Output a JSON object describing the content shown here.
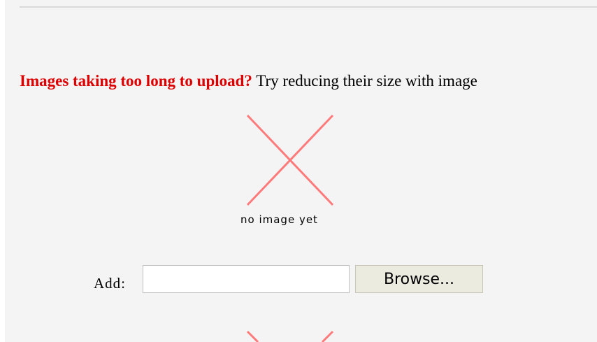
{
  "upload_tip": {
    "warning": "Images taking too long to upload?",
    "suggestion": " Try reducing their size with image"
  },
  "image_slot_1": {
    "placeholder_icon": "broken-image-x-icon",
    "caption": "no image yet"
  },
  "add_field": {
    "label": "Add:",
    "value": "",
    "placeholder": "",
    "browse_label": "Browse..."
  },
  "image_slot_2": {
    "placeholder_icon": "broken-image-x-icon"
  },
  "colors": {
    "warning_text": "#dd0000",
    "placeholder_x": "#ff7a7a",
    "panel_background": "#f4f4f4"
  }
}
